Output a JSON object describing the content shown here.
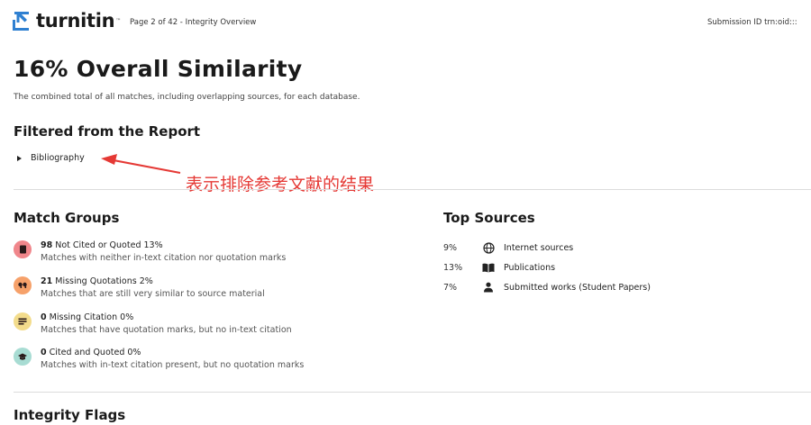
{
  "header": {
    "logo_text": "turnitin",
    "logo_tm": "™",
    "page_info": "Page 2 of 42 - Integrity Overview",
    "submission": "Submission ID  trn:oid:::"
  },
  "title": "16%  Overall Similarity",
  "subtitle": "The combined total of all matches, including overlapping sources, for each database.",
  "filtered": {
    "heading": "Filtered from the Report",
    "items": [
      "Bibliography"
    ]
  },
  "annotation": {
    "text": "表示排除参考文献的结果",
    "color": "#e53935"
  },
  "match_groups": {
    "heading": "Match Groups",
    "items": [
      {
        "count": "98",
        "label": "Not Cited or Quoted",
        "percent": "13%",
        "desc": "Matches with neither in-text citation nor quotation marks",
        "icon": "document-icon",
        "color": "#f0868b"
      },
      {
        "count": "21",
        "label": "Missing Quotations",
        "percent": "2%",
        "desc": "Matches that are still very similar to source material",
        "icon": "quote-icon",
        "color": "#f6a16a"
      },
      {
        "count": "0",
        "label": "Missing Citation",
        "percent": "0%",
        "desc": "Matches that have quotation marks, but no in-text citation",
        "icon": "lines-icon",
        "color": "#f3dc8c"
      },
      {
        "count": "0",
        "label": "Cited and Quoted",
        "percent": "0%",
        "desc": "Matches with in-text citation present, but no quotation marks",
        "icon": "graduation-cap-icon",
        "color": "#a8dcd3"
      }
    ]
  },
  "top_sources": {
    "heading": "Top Sources",
    "items": [
      {
        "percent": "9%",
        "label": "Internet sources",
        "icon": "globe-icon"
      },
      {
        "percent": "13%",
        "label": "Publications",
        "icon": "book-icon"
      },
      {
        "percent": "7%",
        "label": "Submitted works (Student Papers)",
        "icon": "person-icon"
      }
    ]
  },
  "integrity_flags": {
    "heading": "Integrity Flags"
  }
}
